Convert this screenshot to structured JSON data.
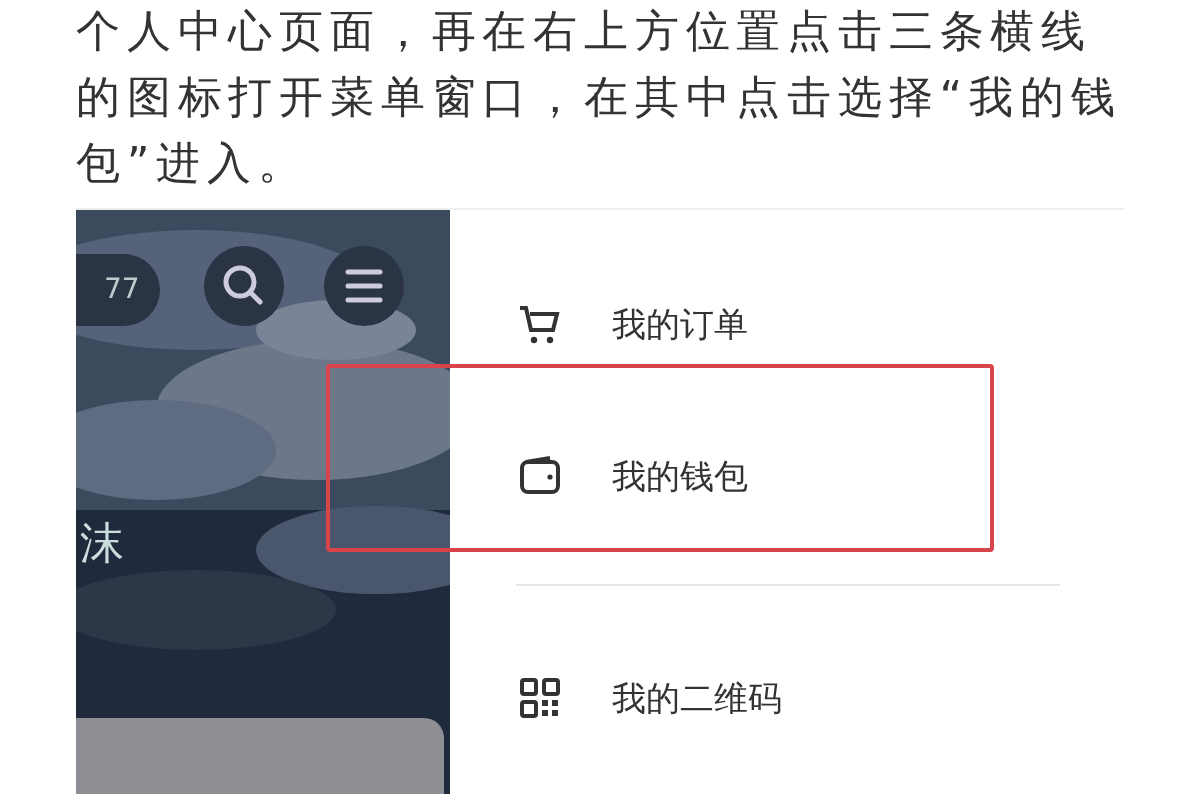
{
  "instruction": "个人中心页面，再在右上方位置点击三条横线的图标打开菜单窗口，在其中点击选择“我的钱包”进入。",
  "screenshot": {
    "header": {
      "count": "77"
    },
    "name_fragment": "沫",
    "menu": [
      {
        "label": "我的订单",
        "kind": "cart",
        "highlighted": false,
        "divider_before": false
      },
      {
        "label": "我的钱包",
        "kind": "wallet",
        "highlighted": true,
        "divider_before": false
      },
      {
        "label": "我的二维码",
        "kind": "qr",
        "highlighted": false,
        "divider_before": true
      }
    ]
  }
}
